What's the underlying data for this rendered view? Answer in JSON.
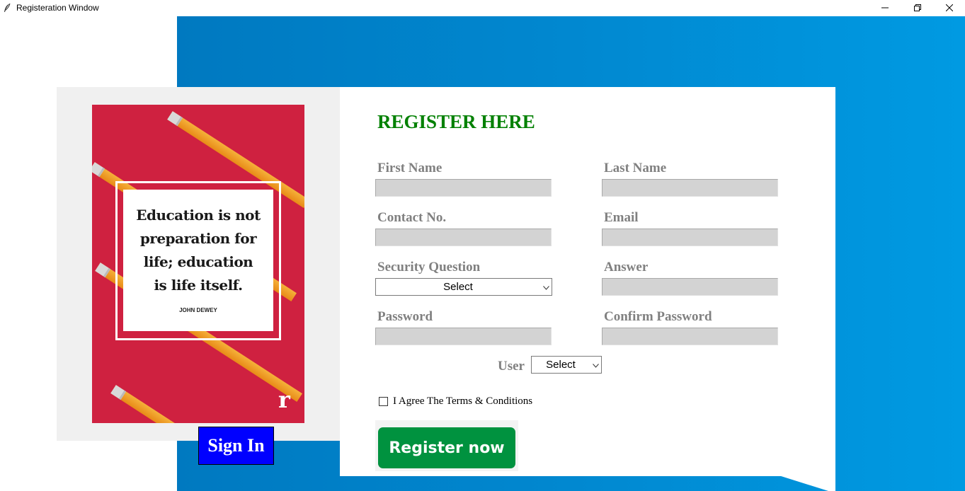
{
  "window": {
    "title": "Registeration Window",
    "icon": "feather-icon",
    "controls": [
      "minimize-icon",
      "restore-icon",
      "close-icon"
    ]
  },
  "poster": {
    "quote": "Education is not preparation for life; education is life itself.",
    "author": "JOHN DEWEY",
    "logo": "r",
    "background_color": "#cf2140"
  },
  "sign_in": {
    "label": "Sign In",
    "color": "#0000ff"
  },
  "form": {
    "title": "REGISTER HERE",
    "title_color": "#008000",
    "labels": {
      "first_name": "First Name",
      "last_name": "Last Name",
      "contact": "Contact No.",
      "email": "Email",
      "security_question": "Security Question",
      "answer": "Answer",
      "password": "Password",
      "confirm_password": "Confirm Password",
      "user": "User"
    },
    "values": {
      "first_name": "",
      "last_name": "",
      "contact": "",
      "email": "",
      "answer": "",
      "password": "",
      "confirm_password": ""
    },
    "security_question_selected": "Select",
    "user_selected": "Select",
    "terms_label": "I Agree The Terms & Conditions",
    "terms_checked": false,
    "register_label": "Register now",
    "register_color": "#00923f"
  },
  "background_gradient": [
    "#0079c0",
    "#009ae2"
  ]
}
